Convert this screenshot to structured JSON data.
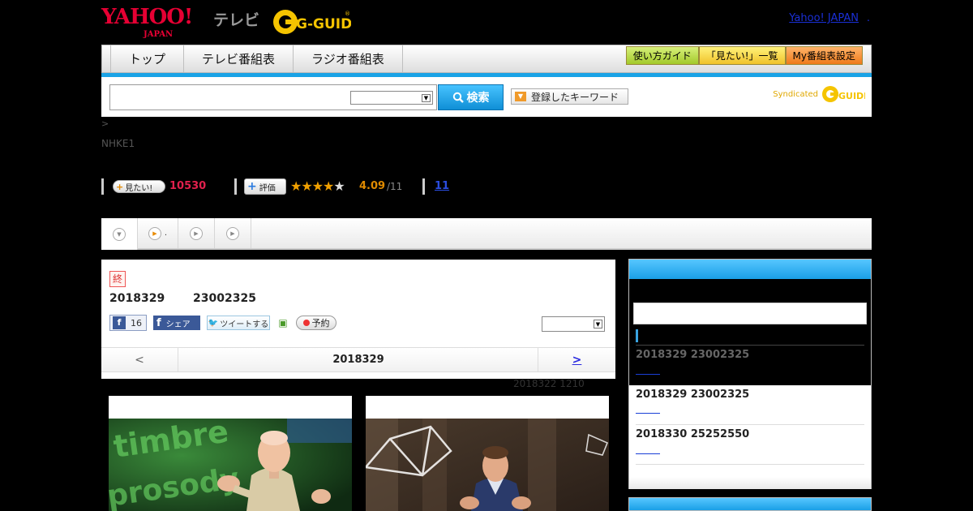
{
  "header": {
    "logo_main": "YAHOO!",
    "logo_sub": "JAPAN",
    "logo_tv": "テレビ",
    "logo_gguide": "G-GUIDE",
    "yahoo_japan_link": "Yahoo! JAPAN",
    "dot": "."
  },
  "nav": {
    "tabs": [
      {
        "label": "トップ"
      },
      {
        "label": "テレビ番組表"
      },
      {
        "label": "ラジオ番組表"
      }
    ],
    "guide_label": "使い方ガイド",
    "want_list_label": "「見たい!」一覧",
    "my_schedule_label": "My番組表設定"
  },
  "search": {
    "value": "",
    "button_label": "検索",
    "keyword_button_label": "登録したキーワード",
    "syndicated_label": "Syndicated",
    "syndicated_logo": "GUIDE"
  },
  "breadcrumb": ">",
  "channel": "NHKE1",
  "stats": {
    "want_button_label": "見たい!",
    "want_count": "10530",
    "rate_button_label": "評価",
    "rating": 4.09,
    "rating_text": "4.09",
    "rating_of": "/11",
    "comment_link": "11"
  },
  "program": {
    "end_badge": "終",
    "air_date": "2018329",
    "air_time": "23002325",
    "fb_count": "16",
    "share_label": "シェア",
    "tweet_label": "ツイートする",
    "reserve_label": "予約",
    "prev_label": "<",
    "current_date": "2018329",
    "next_label": ">",
    "caption": "2018322  1210"
  },
  "sidebar": {
    "items": [
      {
        "text": "2018329  23002325",
        "color": "#666666"
      },
      {
        "text": "2018329  23002325",
        "color": "#222222"
      },
      {
        "text": "2018330  25252550",
        "color": "#222222"
      }
    ]
  },
  "colors": {
    "accent_blue": "#1aa3e6",
    "brand_red": "#e60033",
    "gguide_yellow": "#f5c400",
    "want_count": "#e0204d",
    "rating": "#e08a00"
  }
}
